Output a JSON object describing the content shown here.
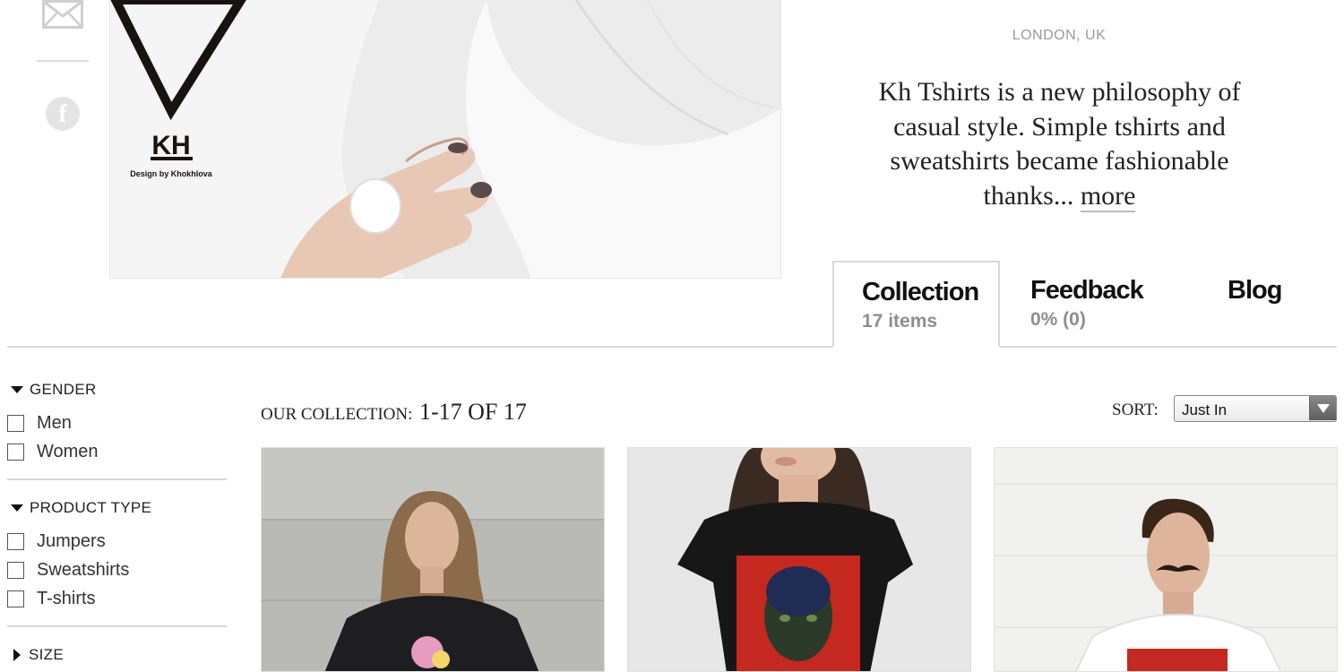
{
  "social": {
    "mail_icon": "mail-icon",
    "facebook_icon": "facebook-icon",
    "facebook_glyph": "f"
  },
  "hero": {
    "logo_text": "KH",
    "logo_subtext": "Design by Khokhlova"
  },
  "shop": {
    "location": "LONDON, UK",
    "description": "Kh Tshirts is a new philosophy of casual style. Simple tshirts and sweatshirts became fashionable thanks...",
    "more_label": "more"
  },
  "tabs": [
    {
      "title": "Collection",
      "subtitle": "17 items",
      "active": true
    },
    {
      "title": "Feedback",
      "subtitle": "0% (0)",
      "active": false
    },
    {
      "title": "Blog",
      "subtitle": "",
      "active": false
    }
  ],
  "filters": {
    "gender": {
      "label": "GENDER",
      "expanded": true,
      "options": [
        "Men",
        "Women"
      ]
    },
    "product_type": {
      "label": "PRODUCT TYPE",
      "expanded": true,
      "options": [
        "Jumpers",
        "Sweatshirts",
        "T-shirts"
      ]
    },
    "size": {
      "label": "SIZE",
      "expanded": false
    }
  },
  "collection": {
    "label": "OUR COLLECTION:",
    "count": "1-17 OF 17",
    "sort_label": "SORT:",
    "sort_value": "Just In"
  },
  "colors": {
    "accent": "#111111",
    "muted": "#8e8e8e",
    "divider": "#d8d8d8"
  }
}
